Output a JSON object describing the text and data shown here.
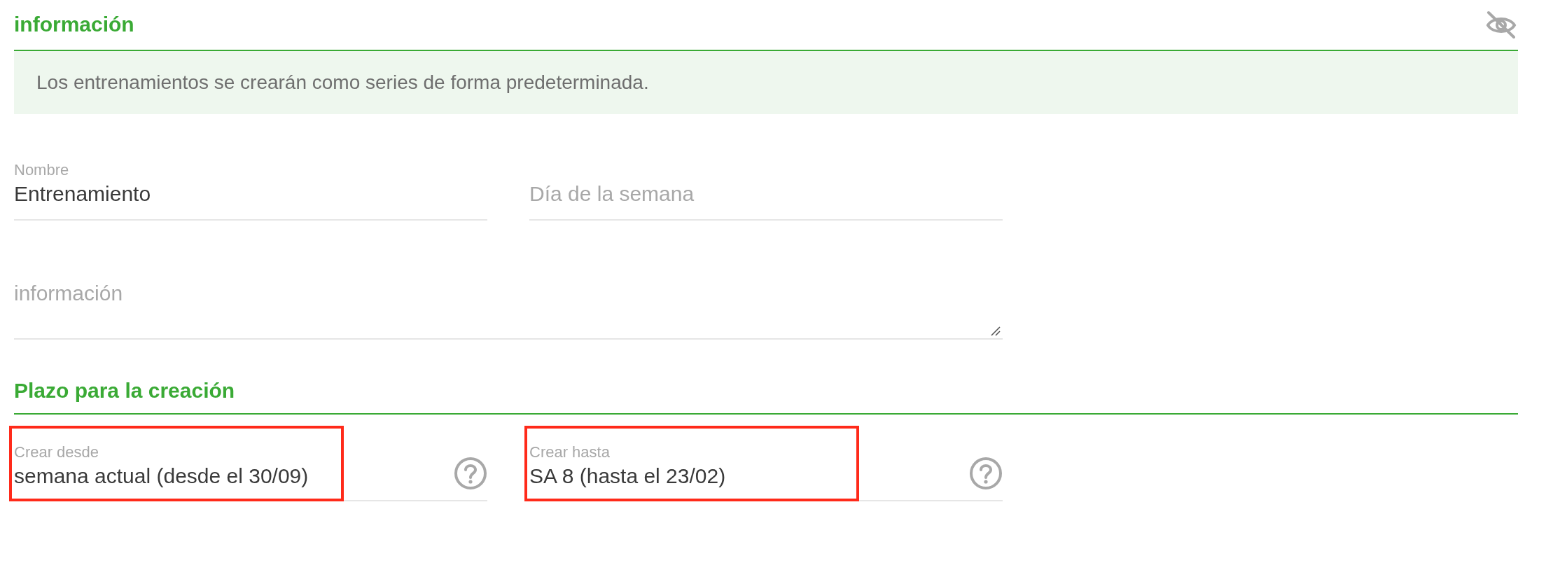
{
  "info_section": {
    "title": "información",
    "notice": "Los entrenamientos se crearán como series de forma predeterminada.",
    "fields": [
      {
        "kind": "text",
        "label": "Nombre",
        "value": "Entrenamiento"
      },
      {
        "kind": "placeholder",
        "placeholder": "Día de la semana"
      }
    ],
    "textarea": {
      "placeholder": "información"
    }
  },
  "period_section": {
    "title": "Plazo para la creación",
    "fields": [
      {
        "label": "Crear desde",
        "value": "semana actual (desde el 30/09)",
        "highlighted": true
      },
      {
        "label": "Crear hasta",
        "value": "SA 8 (hasta el 23/02)",
        "highlighted": true
      }
    ]
  }
}
